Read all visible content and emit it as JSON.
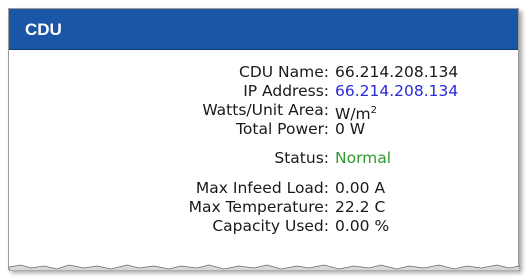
{
  "panel": {
    "title": "CDU"
  },
  "fields": {
    "cdu_name": {
      "label": "CDU Name:",
      "value": "66.214.208.134"
    },
    "ip_address": {
      "label": "IP Address:",
      "value": "66.214.208.134"
    },
    "watts_unit_area": {
      "label": "Watts/Unit Area:",
      "value": "W/m",
      "superscript": "2"
    },
    "total_power": {
      "label": "Total Power:",
      "value": "0 W"
    },
    "status": {
      "label": "Status:",
      "value": "Normal"
    },
    "max_infeed_load": {
      "label": "Max Infeed Load:",
      "value": "0.00 A"
    },
    "max_temperature": {
      "label": "Max Temperature:",
      "value": "22.2 C"
    },
    "capacity_used": {
      "label": "Capacity Used:",
      "value": "0.00 %"
    }
  },
  "colors": {
    "header_bg": "#1a56a6",
    "link_blue": "#2a2ad6",
    "status_green": "#2e9a2e"
  }
}
